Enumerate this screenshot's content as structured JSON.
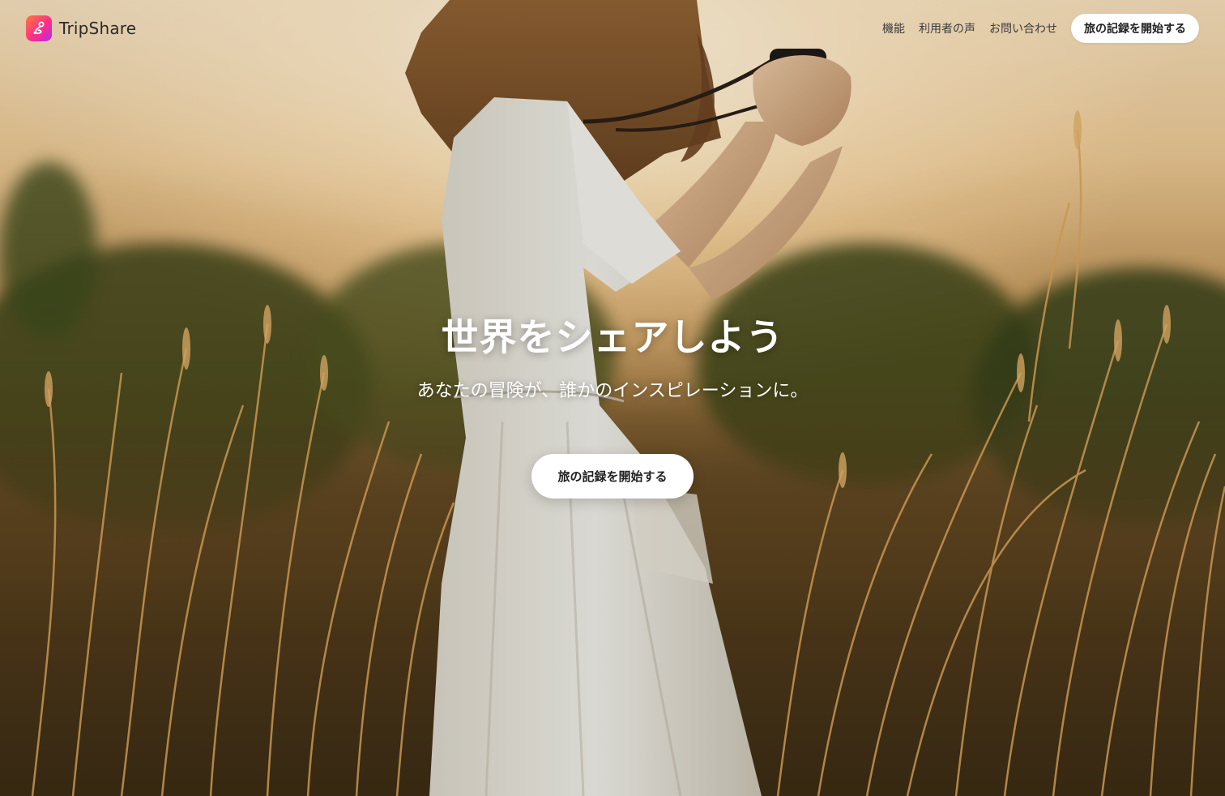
{
  "brand": {
    "name": "TripShare",
    "logo_icon": "route-pin-icon",
    "logo_gradient": [
      "#ff7a3d",
      "#ff2d87",
      "#b12cf0"
    ]
  },
  "nav": {
    "items": [
      {
        "label": "機能"
      },
      {
        "label": "利用者の声"
      },
      {
        "label": "お問い合わせ"
      }
    ],
    "cta_label": "旅の記録を開始する"
  },
  "hero": {
    "title": "世界をシェアしよう",
    "subtitle": "あなたの冒険が、誰かのインスピレーションに。",
    "cta_label": "旅の記録を開始する",
    "background_image": "woman-with-camera-in-golden-field"
  }
}
